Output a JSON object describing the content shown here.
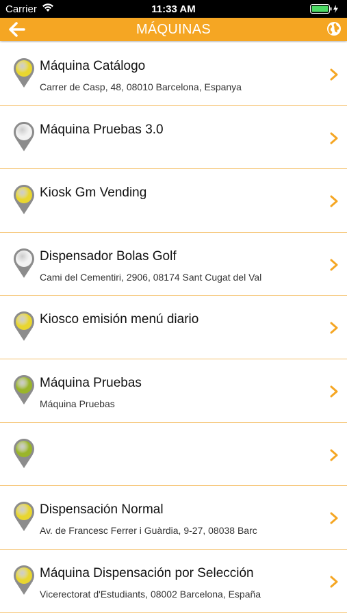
{
  "status_bar": {
    "carrier": "Carrier",
    "time": "11:33 AM",
    "icons": [
      "wifi-icon",
      "battery-icon",
      "charging-icon"
    ]
  },
  "nav": {
    "title": "MÁQUINAS",
    "left_icon": "back-arrow-icon",
    "right_icon": "globe-icon",
    "color": "#f5a623"
  },
  "colors": {
    "accent": "#f5a623",
    "separator": "#f5c16c",
    "pin_yellow": "#e8d630",
    "pin_green": "#9ab52a",
    "pin_white": "#f2f2f2",
    "pin_stem": "#8c8c8c"
  },
  "machines": [
    {
      "name": "Máquina Catálogo",
      "address": "Carrer de Casp, 48, 08010 Barcelona, Espanya",
      "pin": "yellow"
    },
    {
      "name": "Máquina Pruebas 3.0",
      "address": "",
      "pin": "white"
    },
    {
      "name": "Kiosk Gm Vending",
      "address": "",
      "pin": "yellow"
    },
    {
      "name": "Dispensador Bolas Golf",
      "address": "Cami del Cementiri, 2906, 08174 Sant Cugat del Val",
      "pin": "white"
    },
    {
      "name": "Kiosco emisión menú diario",
      "address": "",
      "pin": "yellow"
    },
    {
      "name": "Máquina Pruebas",
      "address": "Máquina Pruebas",
      "pin": "green"
    },
    {
      "name": "",
      "address": "",
      "pin": "green"
    },
    {
      "name": "Dispensación Normal",
      "address": "Av. de Francesc Ferrer i Guàrdia, 9-27, 08038 Barc",
      "pin": "yellow"
    },
    {
      "name": "Máquina Dispensación por Selección",
      "address": "Vicerectorat d'Estudiants, 08002 Barcelona, España",
      "pin": "yellow"
    }
  ]
}
